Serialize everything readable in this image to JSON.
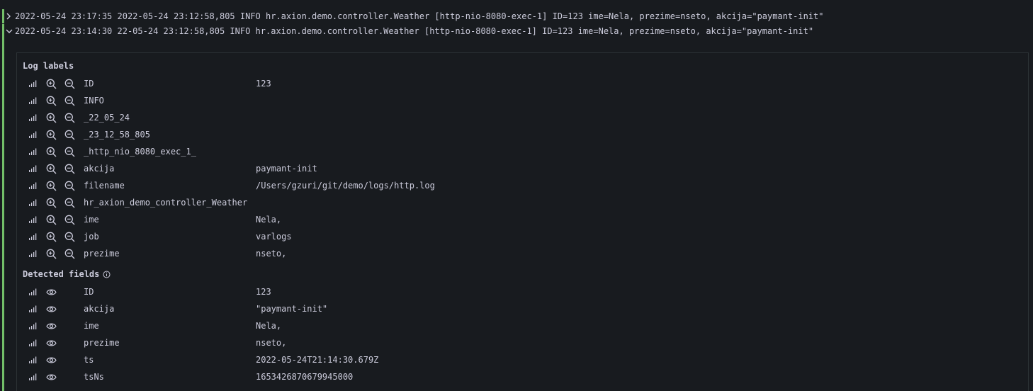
{
  "log_rows": [
    {
      "text": "2022-05-24 23:17:35 2022-05-24 23:12:58,805 INFO hr.axion.demo.controller.Weather [http-nio-8080-exec-1] ID=123 ime=Nela, prezime=nseto, akcija=\"paymant-init\"",
      "expanded": false
    },
    {
      "text": "2022-05-24 23:14:30 22-05-24 23:12:58,805 INFO hr.axion.demo.controller.Weather [http-nio-8080-exec-1] ID=123 ime=Nela, prezime=nseto, akcija=\"paymant-init\"",
      "expanded": true
    }
  ],
  "log_labels": {
    "title": "Log labels",
    "rows": [
      {
        "key": "ID",
        "value": "123"
      },
      {
        "key": "INFO",
        "value": ""
      },
      {
        "key": "_22_05_24",
        "value": ""
      },
      {
        "key": "_23_12_58_805",
        "value": ""
      },
      {
        "key": "_http_nio_8080_exec_1_",
        "value": ""
      },
      {
        "key": "akcija",
        "value": "paymant-init"
      },
      {
        "key": "filename",
        "value": "/Users/gzuri/git/demo/logs/http.log"
      },
      {
        "key": "hr_axion_demo_controller_Weather",
        "value": ""
      },
      {
        "key": "ime",
        "value": "Nela,"
      },
      {
        "key": "job",
        "value": "varlogs"
      },
      {
        "key": "prezime",
        "value": "nseto,"
      }
    ]
  },
  "detected_fields": {
    "title": "Detected fields",
    "rows": [
      {
        "key": "ID",
        "value": "123"
      },
      {
        "key": "akcija",
        "value": "\"paymant-init\""
      },
      {
        "key": "ime",
        "value": "Nela,"
      },
      {
        "key": "prezime",
        "value": "nseto,"
      },
      {
        "key": "ts",
        "value": "2022-05-24T21:14:30.679Z"
      },
      {
        "key": "tsNs",
        "value": "1653426870679945000"
      }
    ]
  },
  "colors": {
    "background": "#181b1f",
    "text": "#ccccdc",
    "level_info": "#73bf69",
    "border": "#2c3235"
  },
  "icons": {
    "stats": "bar-chart-icon",
    "filter_for": "zoom-in-icon",
    "filter_out": "zoom-out-icon",
    "toggle_field": "eye-icon",
    "info": "info-circle-icon",
    "collapsed": "chevron-right-icon",
    "expanded": "chevron-down-icon"
  }
}
